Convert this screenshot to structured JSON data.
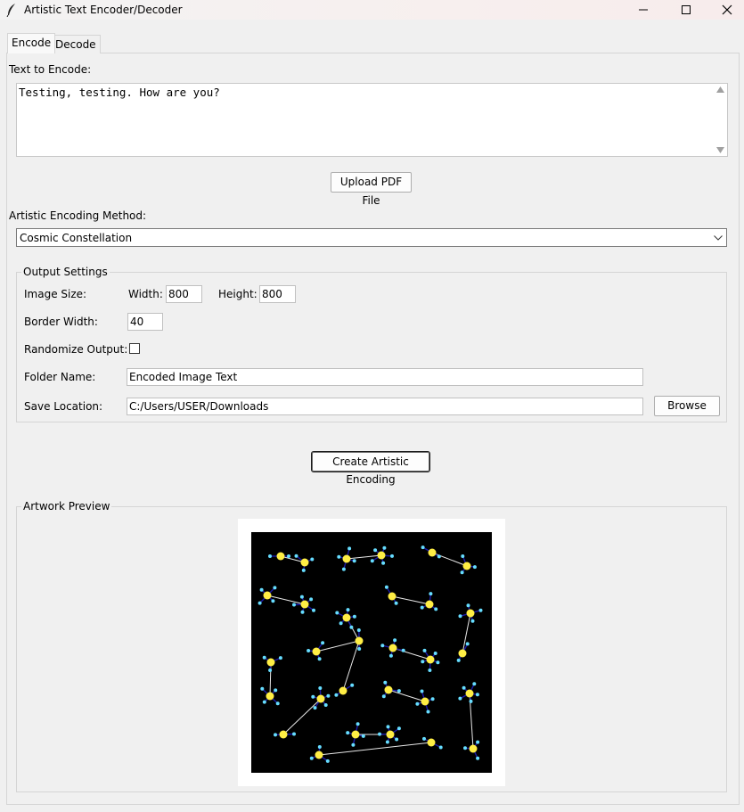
{
  "window": {
    "title": "Artistic Text Encoder/Decoder",
    "icon": "feather-icon",
    "controls": [
      "minimize-icon",
      "maximize-icon",
      "close-icon"
    ]
  },
  "tabs": [
    {
      "label": "Encode",
      "active": true
    },
    {
      "label": "Decode",
      "active": false
    }
  ],
  "encode": {
    "text_label": "Text to Encode:",
    "text_value": "Testing, testing. How are you?",
    "upload_button": "Upload PDF File",
    "method_label": "Artistic Encoding Method:",
    "method_value": "Cosmic Constellation",
    "output_settings": {
      "title": "Output Settings",
      "image_size_label": "Image Size:",
      "width_label": "Width:",
      "width_value": "800",
      "height_label": "Height:",
      "height_value": "800",
      "border_width_label": "Border Width:",
      "border_width_value": "40",
      "randomize_label": "Randomize Output:",
      "randomize_checked": false,
      "folder_name_label": "Folder Name:",
      "folder_name_value": "Encoded Image Text",
      "save_location_label": "Save Location:",
      "save_location_value": "C:/Users/USER/Downloads",
      "browse_button": "Browse"
    },
    "create_button": "Create Artistic Encoding",
    "preview": {
      "title": "Artwork Preview"
    }
  },
  "colors": {
    "star_core": "#ffee44",
    "star_satellite": "#66ddff",
    "spoke": "#1a1aa8",
    "constellation_line": "#e8e8e8",
    "preview_background": "#000000"
  }
}
